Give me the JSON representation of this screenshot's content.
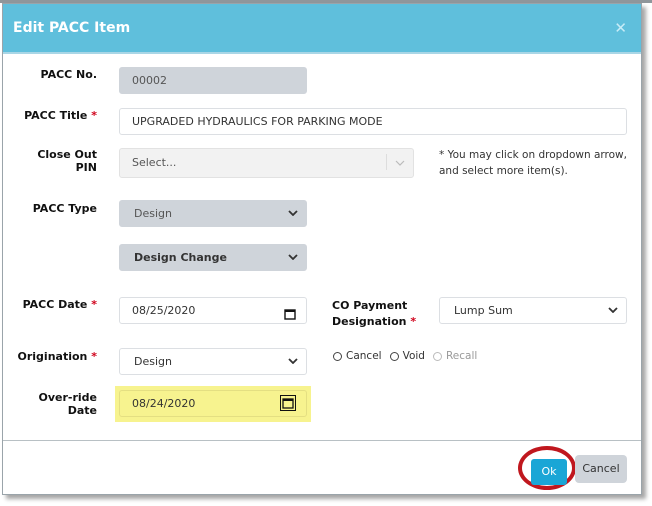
{
  "modal": {
    "title": "Edit PACC Item",
    "close_icon": "close-icon"
  },
  "fields": {
    "pacc_no": {
      "label": "PACC No.",
      "value": "00002"
    },
    "pacc_title": {
      "label": "PACC Title",
      "required_mark": "*",
      "value": "UPGRADED HYDRAULICS FOR PARKING MODE"
    },
    "close_out_pin": {
      "label": "Close Out PIN",
      "placeholder": "Select...",
      "note": "* You may click on dropdown arrow, and select more item(s)."
    },
    "pacc_type": {
      "label": "PACC Type",
      "value": "Design",
      "subtype_value": "Design Change"
    },
    "pacc_date": {
      "label": "PACC Date",
      "required_mark": "*",
      "value": "08/25/2020"
    },
    "co_payment": {
      "label_line1": "CO Payment",
      "label_line2": "Designation",
      "required_mark": "*",
      "value": "Lump Sum"
    },
    "origination": {
      "label": "Origination",
      "required_mark": "*",
      "value": "Design"
    },
    "override_date": {
      "label": "Over-ride Date",
      "value": "08/24/2020"
    },
    "status_radios": [
      {
        "label": "Cancel",
        "disabled": false
      },
      {
        "label": "Void",
        "disabled": false
      },
      {
        "label": "Recall",
        "disabled": true
      }
    ]
  },
  "footer": {
    "ok_label": "Ok",
    "cancel_label": "Cancel"
  },
  "colors": {
    "header": "#5fbfdc",
    "ok_button": "#1aa6d6",
    "highlight": "#f7f38f",
    "annotation_ring": "#c0171e"
  }
}
